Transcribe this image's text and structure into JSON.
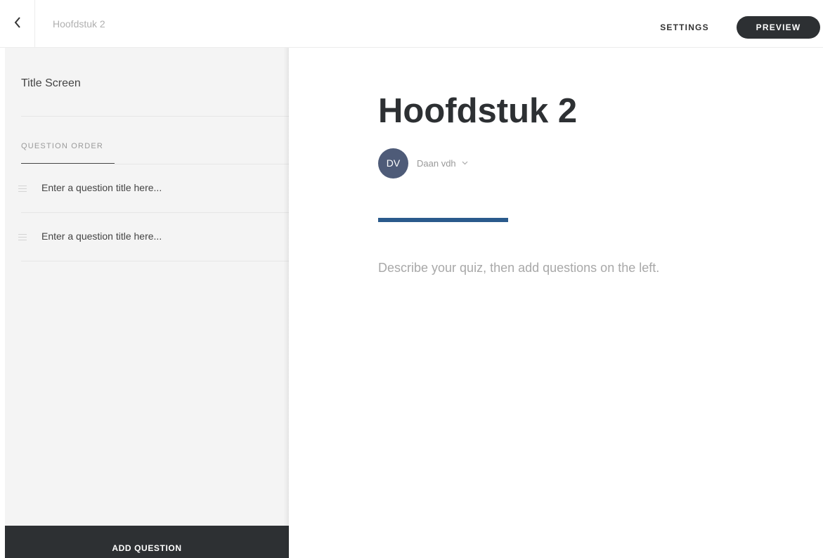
{
  "header": {
    "back_icon": "chevron-left-icon",
    "doc_title": "Hoofdstuk 2",
    "settings_label": "SETTINGS",
    "preview_label": "PREVIEW"
  },
  "sidebar": {
    "title_screen": "Title Screen",
    "question_order_label": "QUESTION ORDER",
    "questions": [
      {
        "placeholder": "Enter a question title here..."
      },
      {
        "placeholder": "Enter a question title here..."
      }
    ],
    "add_question_label": "ADD QUESTION"
  },
  "main": {
    "title": "Hoofdstuk 2",
    "author": {
      "initials": "DV",
      "name": "Daan vdh",
      "dropdown_icon": "chevron-down-icon"
    },
    "description_placeholder": "Describe your quiz, then add questions on the left."
  },
  "colors": {
    "dark": "#2d3033",
    "accent_bar": "#2a5a8c",
    "avatar": "#4e5b78",
    "sidebar_bg": "#f4f4f4"
  }
}
